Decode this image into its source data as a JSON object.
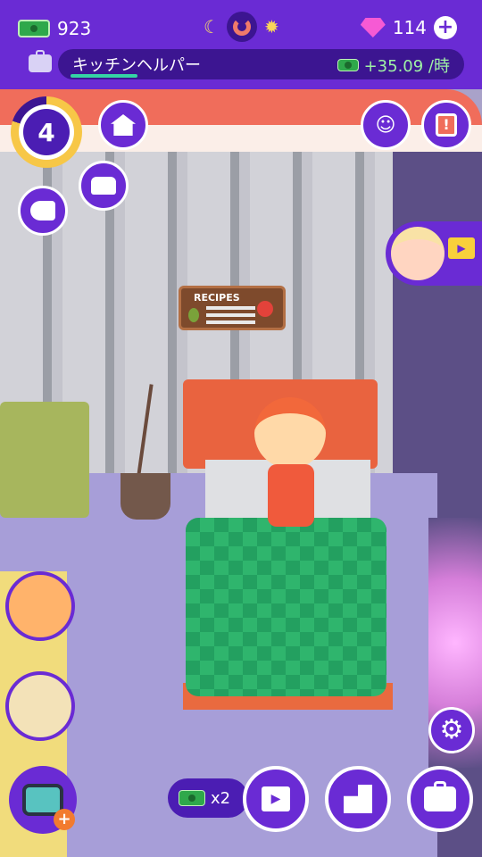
{
  "hud": {
    "cash": "923",
    "gems": "114",
    "job_title": "キッチンヘルパー",
    "income_rate": "+35.09 /時"
  },
  "room": {
    "sign_title": "RECIPES"
  },
  "player": {
    "level": "4"
  },
  "boost": {
    "multiplier": "x2"
  },
  "icons": {
    "cash": "cash-icon",
    "gem": "gem-icon",
    "moon": "moon-icon",
    "sun": "sun-icon",
    "home": "home-icon",
    "furniture": "armchair-icon",
    "dryer": "hair-dryer-icon",
    "social": "people-icon",
    "alert": "alert-icon",
    "settings": "gear-icon",
    "video": "video-icon",
    "delivery": "boxes-icon",
    "jobs": "briefcase-icon"
  },
  "colors": {
    "primary": "#6a2bd4",
    "dark": "#3c1591",
    "accent": "#f06d5b",
    "gem": "#f65ad4",
    "cash": "#2fa84b"
  }
}
